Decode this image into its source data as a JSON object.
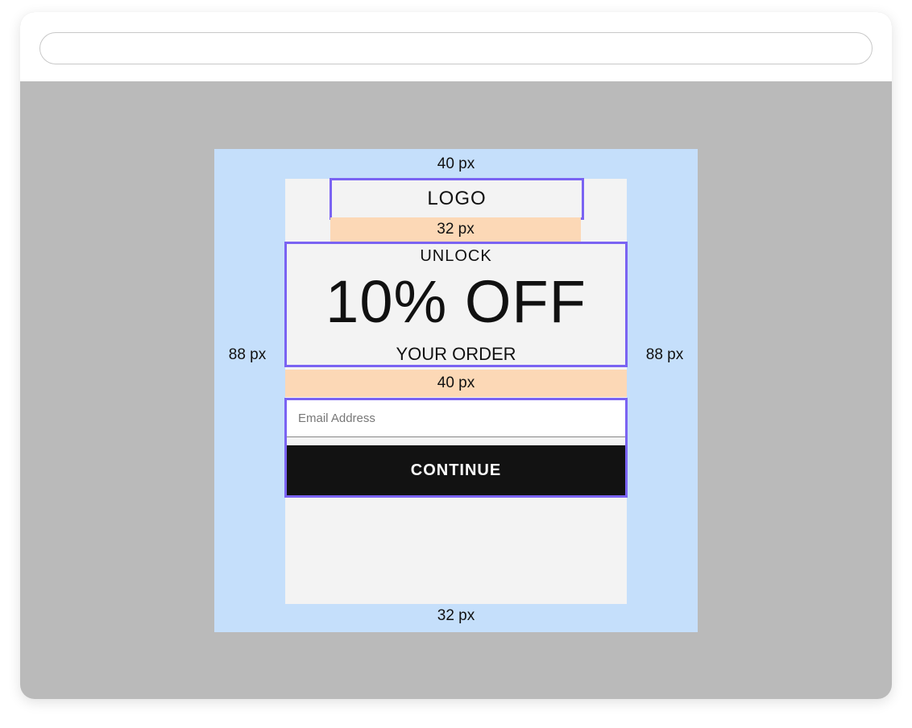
{
  "browser": {
    "address_value": ""
  },
  "annotations": {
    "top": "40 px",
    "bottom": "32 px",
    "left": "88 px",
    "right": "88 px",
    "logo_gap": "32 px",
    "headline_gap": "40 px"
  },
  "popup": {
    "logo": "LOGO",
    "unlock": "UNLOCK",
    "offer": "10% OFF",
    "your_order": "YOUR ORDER",
    "email_placeholder": "Email Address",
    "continue_label": "CONTINUE"
  },
  "colors": {
    "padding_area": "#c5dffb",
    "gap_highlight": "#fcd8b6",
    "outline": "#7a63f2",
    "popup_bg": "#f3f3f3",
    "button_bg": "#121212"
  }
}
